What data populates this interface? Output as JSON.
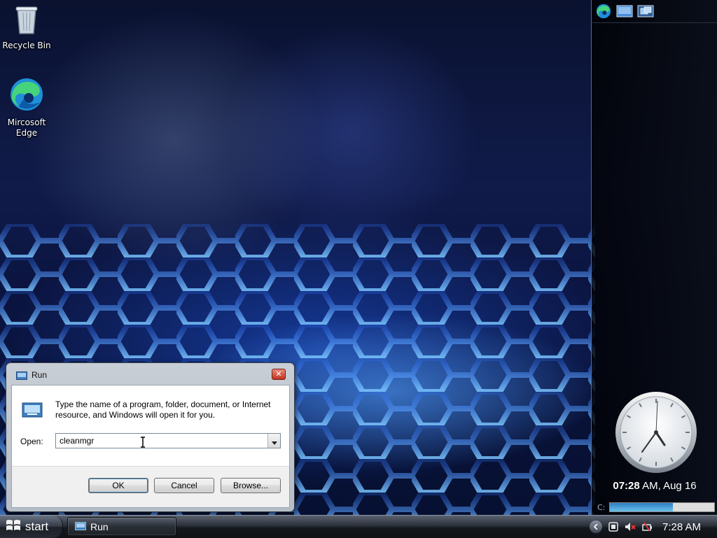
{
  "desktop": {
    "icons": [
      {
        "label": "Recycle Bin",
        "icon": "recycle-bin-icon"
      },
      {
        "label": "Mircosoft Edge",
        "icon": "edge-icon"
      }
    ]
  },
  "sidebar": {
    "tools": [
      "edge-icon",
      "desktop-icon",
      "camera-icon"
    ],
    "clock_time_bold": "07:28",
    "clock_time_rest": " AM, Aug 16",
    "drive_label": "C:",
    "drive_fill_fraction": 0.6
  },
  "run_dialog": {
    "title": "Run",
    "close_glyph": "✕",
    "description": "Type the name of a program, folder, document, or Internet resource, and Windows will open it for you.",
    "open_label": "Open:",
    "open_value": "cleanmgr",
    "ok_label": "OK",
    "cancel_label": "Cancel",
    "browse_label": "Browse..."
  },
  "taskbar": {
    "start_label": "start",
    "tasks": [
      {
        "label": "Run",
        "icon": "run-icon"
      }
    ],
    "tray_clock": "7:28 AM",
    "tray_icons": [
      "show-hidden-icons-chevron",
      "network-icon",
      "volume-muted-icon",
      "power-icon"
    ]
  },
  "colors": {
    "taskbar_dark": "#15191f",
    "hex_glow": "#3a8cff",
    "ok_focus": "#3c7fb1"
  }
}
